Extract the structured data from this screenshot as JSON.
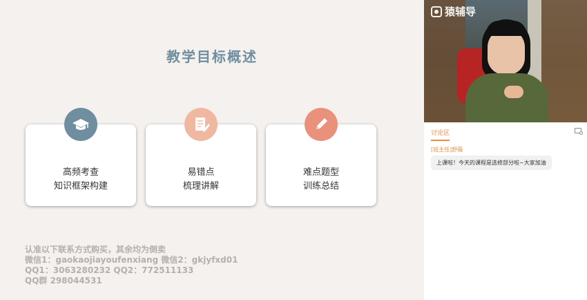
{
  "slide": {
    "title": "教学目标概述",
    "cards": [
      {
        "line1": "高频考查",
        "line2": "知识框架构建",
        "icon": "graduation-cap-icon",
        "color": "#6f8fa0"
      },
      {
        "line1": "易错点",
        "line2": "梳理讲解",
        "icon": "document-edit-icon",
        "color": "#f0b7a1"
      },
      {
        "line1": "难点题型",
        "line2": "训练总结",
        "icon": "pencil-icon",
        "color": "#e9917a"
      }
    ],
    "notice": {
      "line1": "认准以下联系方式购买，其余均为倒卖",
      "line2": "微信1：gaokaojiayoufenxiang 微信2：gkjyfxd01",
      "line3": "QQ1：3063280232 QQ2：772511133",
      "line4": "QQ群 298044531"
    }
  },
  "sidebar": {
    "logo_text": "猿辅导",
    "tab_label": "讨论区",
    "messages": [
      {
        "sender": "[班主任]舒薇",
        "text": "上课啦！今天的课程是选修部分啦~大家加油"
      }
    ]
  }
}
